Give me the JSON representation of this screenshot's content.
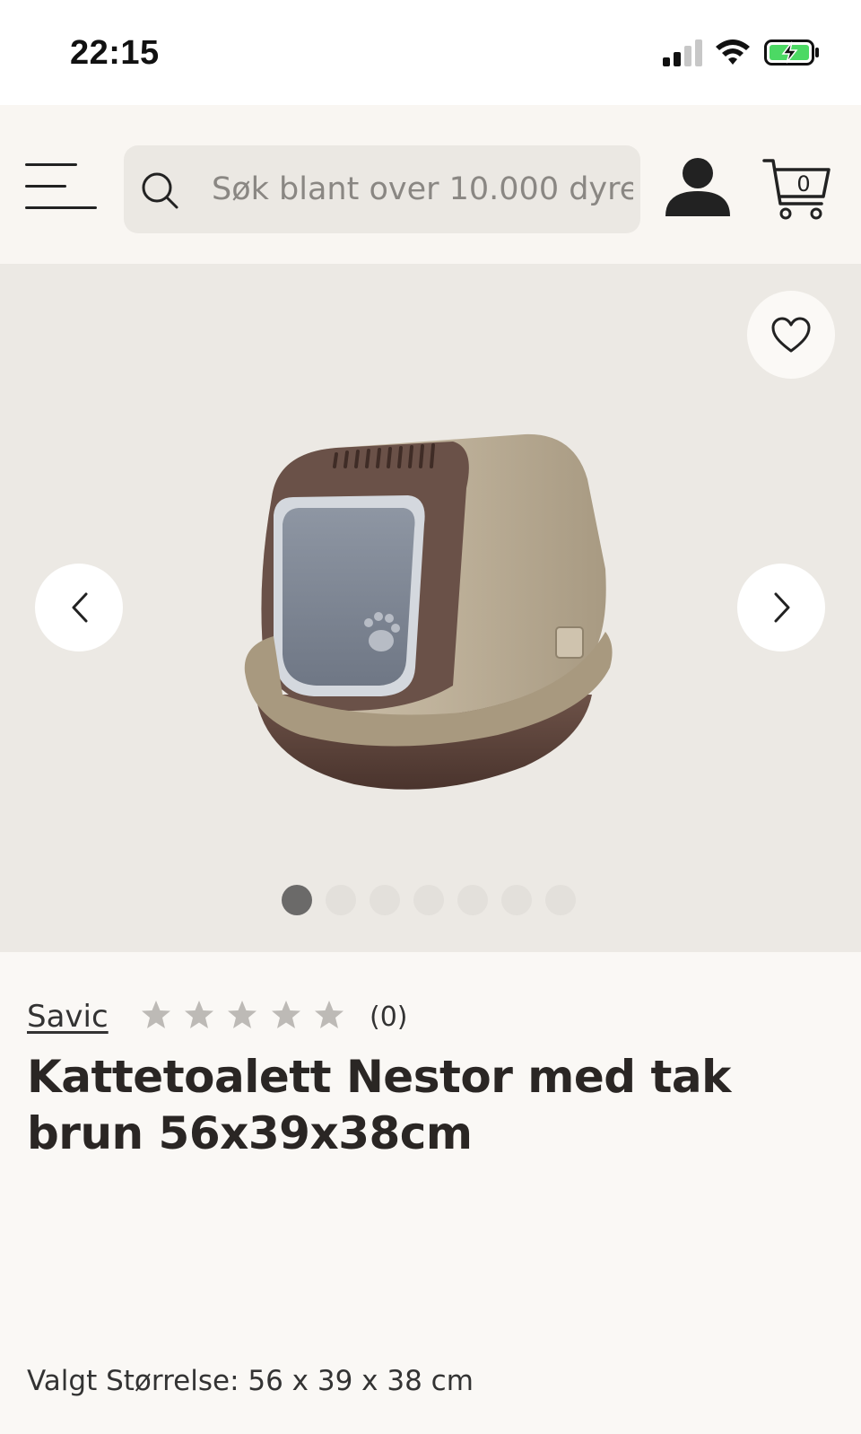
{
  "status_bar": {
    "time": "22:15",
    "icons": [
      "cellular-signal-icon",
      "wifi-icon",
      "battery-charging-icon"
    ]
  },
  "header": {
    "menu_icon": "hamburger-menu-icon",
    "search": {
      "placeholder": "Søk blant over 10.000 dyre",
      "icon": "search-icon"
    },
    "account_icon": "user-icon",
    "cart": {
      "icon": "cart-icon",
      "count": "0"
    }
  },
  "gallery": {
    "favorite_icon": "heart-icon",
    "prev_icon": "chevron-left-icon",
    "next_icon": "chevron-right-icon",
    "image_count": 7,
    "active_index": 0
  },
  "product": {
    "brand": "Savic",
    "rating": {
      "stars": 5,
      "filled": 0,
      "count_label": "(0)"
    },
    "title": "Kattetoalett Nestor med tak brun 56x39x38cm",
    "selected_size": "Valgt Størrelse: 56 x 39 x 38 cm"
  },
  "colors": {
    "background": "#faf8f5",
    "gallery_bg": "#ece9e4",
    "search_bg": "#ebe8e3",
    "text": "#2a2624",
    "star_empty": "#bdbab6",
    "dot_active": "#6b6a69",
    "dot_inactive": "#e3e0db",
    "battery_green": "#4cd964"
  }
}
